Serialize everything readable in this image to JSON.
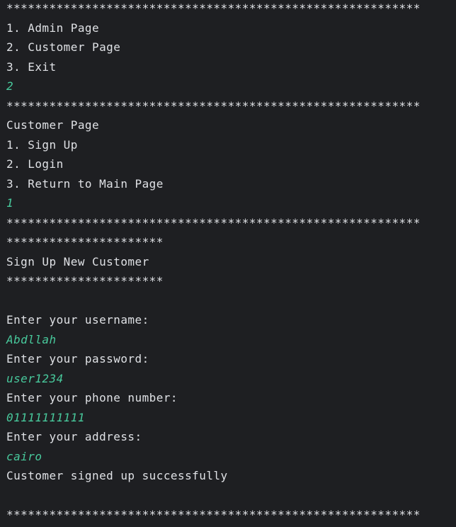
{
  "console": {
    "lines": [
      {
        "type": "stars",
        "text": "**********************************************************"
      },
      {
        "type": "output",
        "text": "1. Admin Page"
      },
      {
        "type": "output",
        "text": "2. Customer Page"
      },
      {
        "type": "output",
        "text": "3. Exit"
      },
      {
        "type": "input",
        "text": "2"
      },
      {
        "type": "stars",
        "text": "**********************************************************"
      },
      {
        "type": "output",
        "text": "Customer Page"
      },
      {
        "type": "output",
        "text": "1. Sign Up"
      },
      {
        "type": "output",
        "text": "2. Login"
      },
      {
        "type": "output",
        "text": "3. Return to Main Page"
      },
      {
        "type": "input",
        "text": "1"
      },
      {
        "type": "stars",
        "text": "**********************************************************"
      },
      {
        "type": "stars",
        "text": "**********************"
      },
      {
        "type": "output",
        "text": "Sign Up New Customer"
      },
      {
        "type": "stars",
        "text": "**********************"
      },
      {
        "type": "blank",
        "text": ""
      },
      {
        "type": "output",
        "text": "Enter your username:"
      },
      {
        "type": "input",
        "text": "Abdllah"
      },
      {
        "type": "output",
        "text": "Enter your password:"
      },
      {
        "type": "input",
        "text": "user1234"
      },
      {
        "type": "output",
        "text": "Enter your phone number:"
      },
      {
        "type": "input",
        "text": "01111111111"
      },
      {
        "type": "output",
        "text": "Enter your address:"
      },
      {
        "type": "input",
        "text": "cairo"
      },
      {
        "type": "output",
        "text": "Customer signed up successfully"
      },
      {
        "type": "blank",
        "text": ""
      },
      {
        "type": "stars",
        "text": "**********************************************************"
      }
    ]
  },
  "colors": {
    "background": "#1e1f22",
    "output_text": "#dfe1e5",
    "input_text": "#48c99c"
  }
}
